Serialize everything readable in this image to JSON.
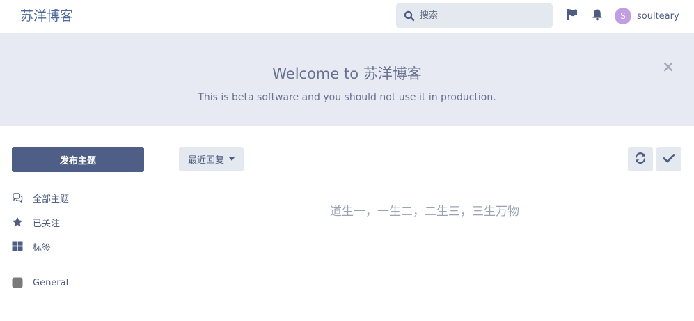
{
  "header": {
    "brand": "苏洋博客",
    "search_placeholder": "搜索",
    "flag_icon": "flag-icon",
    "bell_icon": "bell-icon",
    "user": {
      "initial": "S",
      "name": "soulteary",
      "avatar_color": "#c29de0"
    }
  },
  "hero": {
    "title": "Welcome to 苏洋博客",
    "subtitle": "This is beta software and you should not use it in production.",
    "close_icon": "close-icon"
  },
  "sidebar": {
    "start_discussion": "发布主题",
    "items": [
      {
        "label": "全部主题",
        "icon": "comments-icon"
      },
      {
        "label": "已关注",
        "icon": "star-icon"
      },
      {
        "label": "标签",
        "icon": "grid-icon"
      },
      {
        "label": "General",
        "icon": "tag-square-icon",
        "color": "#7a7a7a"
      }
    ]
  },
  "toolbar": {
    "sort_label": "最近回复",
    "refresh_icon": "refresh-icon",
    "mark_read_icon": "check-icon"
  },
  "main": {
    "empty_text": "道生一，一生二，二生三，三生万物"
  },
  "colors": {
    "primary": "#4e5e86",
    "hero_bg": "#e7eaf2",
    "control_bg": "#e4e8ef",
    "text": "#4f5d82"
  }
}
